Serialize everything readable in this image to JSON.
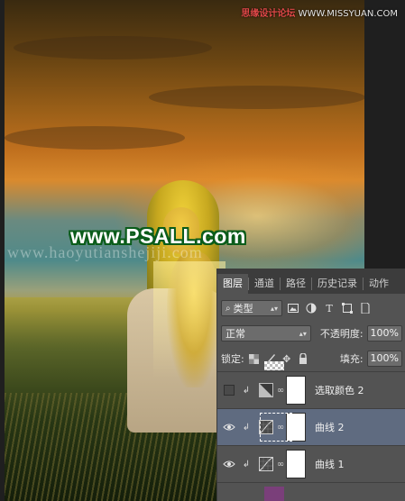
{
  "site_watermark": {
    "cn": "思缘设计论坛",
    "url": "WWW.MISSYUAN.COM"
  },
  "photo_watermark": {
    "url": "www.PSALL.com",
    "faint": "www.haoyutianshejiji.com"
  },
  "colors": {
    "panel_bg": "#535353",
    "tabbar_bg": "#3c3c3c",
    "selected_layer": "#5f6b80",
    "watermark_outline": "#0a5c1a",
    "site_cn": "#e04848"
  },
  "layers_panel": {
    "tabs": [
      {
        "label": "图层",
        "active": true
      },
      {
        "label": "通道",
        "active": false
      },
      {
        "label": "路径",
        "active": false
      },
      {
        "label": "历史记录",
        "active": false
      },
      {
        "label": "动作",
        "active": false
      }
    ],
    "filter": {
      "icon": "search-icon",
      "label": "类型",
      "icons": [
        "image-filter-icon",
        "adjustment-filter-icon",
        "type-filter-icon",
        "shape-filter-icon",
        "smart-object-filter-icon"
      ]
    },
    "blend_mode": "正常",
    "opacity_label": "不透明度:",
    "opacity_value": "100%",
    "lock_label": "锁定:",
    "lock_icons": [
      "lock-transparent-icon",
      "lock-paint-icon",
      "lock-position-icon",
      "lock-all-icon"
    ],
    "fill_label": "填充:",
    "fill_value": "100%",
    "layers": [
      {
        "name": "选取颜色 2",
        "visible": false,
        "selected": false,
        "type": "selective-color"
      },
      {
        "name": "曲线 2",
        "visible": true,
        "selected": true,
        "type": "curves"
      },
      {
        "name": "曲线 1",
        "visible": true,
        "selected": false,
        "type": "curves"
      }
    ]
  }
}
